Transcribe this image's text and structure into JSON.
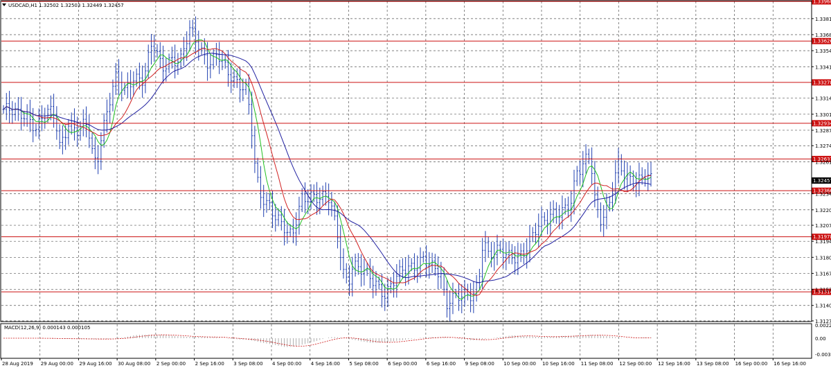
{
  "header": {
    "symbol_label": "USDCAD,H1  1.32502 1.32503 1.32449 1.32457",
    "menu_icon": "triangle-down-icon"
  },
  "macd": {
    "label": "MACD(12,26,9) 0.000143 0.000105",
    "scale": [
      "0.002238",
      "0.00",
      "-0.00322"
    ]
  },
  "colors": {
    "price_bars": "#1f3fb0",
    "ma_fast": "#20c020",
    "ma_mid": "#d02020",
    "ma_slow": "#2020a0",
    "levels": "#cc1010",
    "level_label_bg": "#cc1010",
    "current_price_bg": "#000000",
    "macd_histogram": "#9a9a9a",
    "macd_signal": "#cc1010",
    "grid": "#555555"
  },
  "chart_data": {
    "type": "line",
    "title": "USDCAD,H1",
    "ylim": [
      1.3127,
      1.3396
    ],
    "price_axis_ticks": [
      "1.33815",
      "1.33680",
      "1.33545",
      "1.33410",
      "1.33145",
      "1.33010",
      "1.32875",
      "1.32745",
      "1.32610",
      "1.32340",
      "1.32205",
      "1.32075",
      "1.31940",
      "1.31805",
      "1.31670",
      "1.31535",
      "1.31400",
      "1.31270"
    ],
    "levels": [
      "1.33960",
      "1.33626",
      "1.33278",
      "1.32934",
      "1.32633",
      "1.32366",
      "1.31978",
      "1.31514"
    ],
    "current_price": "1.32457",
    "time_labels": [
      "28 Aug 2019",
      "29 Aug 00:00",
      "29 Aug 16:00",
      "30 Aug 08:00",
      "2 Sep 00:00",
      "2 Sep 16:00",
      "3 Sep 08:00",
      "4 Sep 00:00",
      "4 Sep 16:00",
      "5 Sep 08:00",
      "6 Sep 00:00",
      "6 Sep 16:00",
      "9 Sep 08:00",
      "10 Sep 00:00",
      "10 Sep 16:00",
      "11 Sep 08:00",
      "12 Sep 00:00",
      "12 Sep 16:00",
      "13 Sep 08:00",
      "16 Sep 00:00",
      "16 Sep 16:00"
    ],
    "close_path": [
      [
        0,
        1.3305
      ],
      [
        3,
        1.33
      ],
      [
        5,
        1.3302
      ],
      [
        7,
        1.329
      ],
      [
        9,
        1.33
      ],
      [
        11,
        1.3302
      ],
      [
        12,
        1.3275
      ],
      [
        14,
        1.3295
      ],
      [
        16,
        1.3285
      ],
      [
        18,
        1.3293
      ],
      [
        19,
        1.327
      ],
      [
        20,
        1.326
      ],
      [
        21,
        1.3285
      ],
      [
        22,
        1.33
      ],
      [
        24,
        1.333
      ],
      [
        26,
        1.332
      ],
      [
        28,
        1.3335
      ],
      [
        30,
        1.333
      ],
      [
        32,
        1.336
      ],
      [
        34,
        1.334
      ],
      [
        36,
        1.335
      ],
      [
        38,
        1.3345
      ],
      [
        40,
        1.337
      ],
      [
        42,
        1.336
      ],
      [
        44,
        1.3345
      ],
      [
        46,
        1.335
      ],
      [
        48,
        1.3335
      ],
      [
        50,
        1.333
      ],
      [
        52,
        1.3325
      ],
      [
        53,
        1.33
      ],
      [
        54,
        1.3255
      ],
      [
        55,
        1.323
      ],
      [
        57,
        1.3225
      ],
      [
        59,
        1.3215
      ],
      [
        61,
        1.32
      ],
      [
        62,
        1.3195
      ],
      [
        64,
        1.323
      ],
      [
        66,
        1.3235
      ],
      [
        68,
        1.323
      ],
      [
        70,
        1.3228
      ],
      [
        72,
        1.3195
      ],
      [
        73,
        1.317
      ],
      [
        74,
        1.316
      ],
      [
        75,
        1.3175
      ],
      [
        76,
        1.317
      ],
      [
        78,
        1.3165
      ],
      [
        80,
        1.316
      ],
      [
        82,
        1.315
      ],
      [
        84,
        1.316
      ],
      [
        86,
        1.317
      ],
      [
        88,
        1.3175
      ],
      [
        90,
        1.318
      ],
      [
        92,
        1.317
      ],
      [
        94,
        1.3165
      ],
      [
        95,
        1.314
      ],
      [
        96,
        1.315
      ],
      [
        98,
        1.3148
      ],
      [
        100,
        1.3145
      ],
      [
        101,
        1.3148
      ],
      [
        102,
        1.316
      ],
      [
        103,
        1.32
      ],
      [
        104,
        1.3185
      ],
      [
        106,
        1.3185
      ],
      [
        108,
        1.318
      ],
      [
        110,
        1.3182
      ],
      [
        112,
        1.3188
      ],
      [
        114,
        1.32
      ],
      [
        116,
        1.321
      ],
      [
        118,
        1.322
      ],
      [
        120,
        1.322
      ],
      [
        122,
        1.3225
      ],
      [
        123,
        1.325
      ],
      [
        124,
        1.3255
      ],
      [
        125,
        1.3265
      ],
      [
        126,
        1.327
      ],
      [
        127,
        1.323
      ],
      [
        128,
        1.321
      ],
      [
        130,
        1.322
      ],
      [
        131,
        1.3245
      ],
      [
        132,
        1.326
      ],
      [
        133,
        1.3255
      ],
      [
        134,
        1.325
      ],
      [
        135,
        1.3245
      ],
      [
        137,
        1.3243
      ],
      [
        138,
        1.325
      ],
      [
        139,
        1.3246
      ]
    ]
  }
}
